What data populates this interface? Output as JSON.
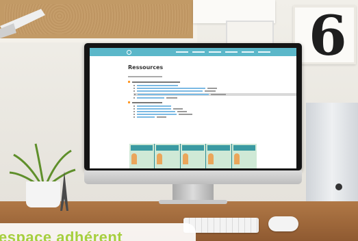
{
  "screen": {
    "page_title": "Ressources"
  },
  "frame_numeral": "6",
  "overlay": {
    "text": "espace adhérent"
  },
  "colors": {
    "nav_bar": "#5bb7c9",
    "section_bullet": "#ff9a2a",
    "link": "#7ab9e3",
    "overlay_text": "#a6cf3e"
  }
}
